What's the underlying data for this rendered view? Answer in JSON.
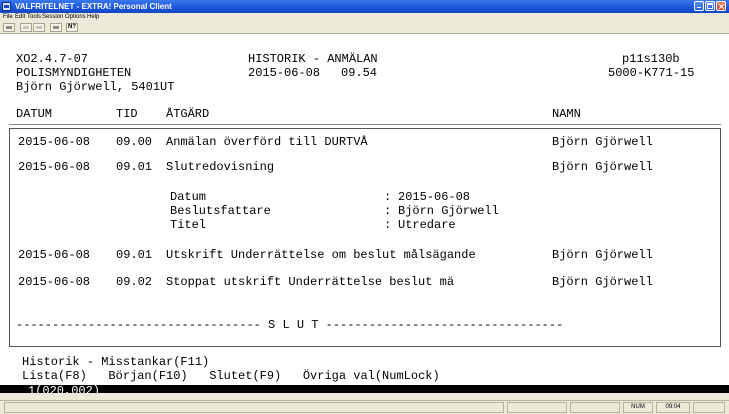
{
  "window": {
    "title": "VALFRITELNET - EXTRA! Personal Client"
  },
  "menu": [
    "File",
    "Edit",
    "Tools",
    "Session",
    "Options",
    "Help"
  ],
  "toolbar": {
    "icons": [
      "paste-icon",
      "copy-icon",
      "cut-icon",
      "quick-pad-icon",
      "help-icon"
    ]
  },
  "terminal": {
    "header": {
      "system_id": "XO2.4.7-07",
      "screen_title": "HISTORIK - ANMÄLAN",
      "program_code": "p11s130b",
      "org": "POLISMYNDIGHETEN",
      "date": "2015-06-08",
      "time": "09.54",
      "case_number": "5000-K771-15",
      "user": "Björn Gjörwell, 5401UT"
    },
    "columns": {
      "datum": "DATUM",
      "tid": "TID",
      "atgard": "ÅTGÄRD",
      "namn": "NAMN"
    },
    "rows": [
      {
        "datum": "2015-06-08",
        "tid": "09.00",
        "atgard": "Anmälan överförd till DURTVÅ",
        "namn": "Björn Gjörwell"
      },
      {
        "datum": "2015-06-08",
        "tid": "09.01",
        "atgard": "Slutredovisning",
        "namn": "Björn Gjörwell"
      },
      {
        "datum": "2015-06-08",
        "tid": "09.01",
        "atgard": "Utskrift Underrättelse om beslut målsägande",
        "namn": "Björn Gjörwell"
      },
      {
        "datum": "2015-06-08",
        "tid": "09.02",
        "atgard": "Stoppat utskrift Underrättelse beslut mä",
        "namn": "Björn Gjörwell"
      }
    ],
    "detail": [
      {
        "label": "Datum",
        "value": "2015-06-08"
      },
      {
        "label": "Beslutsfattare",
        "value": "Björn Gjörwell"
      },
      {
        "label": "Titel",
        "value": "Utredare"
      }
    ],
    "slut_line": "---------------------------------- S L U T ---------------------------------",
    "footer": {
      "line1": "Historik - Misstankar(F11)",
      "line2": "Lista(F8)   Början(F10)   Slutet(F9)   Övriga val(NumLock)",
      "status": "1(020,002)"
    }
  },
  "statusbar": {
    "num": "NUM",
    "clock": "09:04"
  }
}
